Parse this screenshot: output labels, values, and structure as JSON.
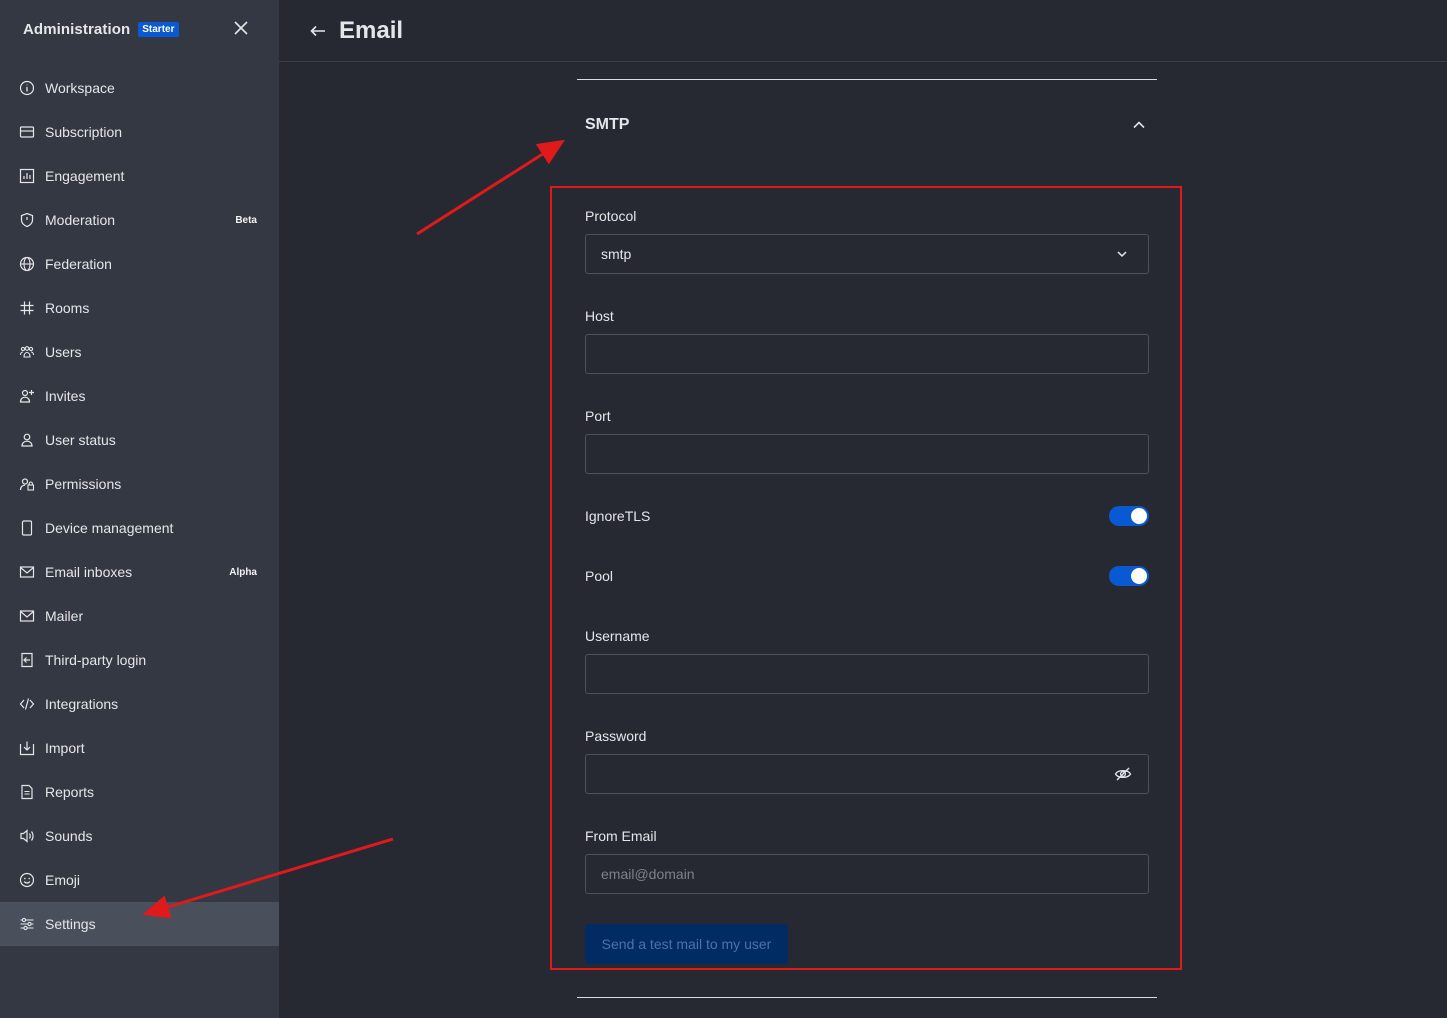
{
  "sidebar": {
    "title": "Administration",
    "badge": "Starter",
    "items": [
      {
        "label": "Workspace",
        "icon": "info-icon"
      },
      {
        "label": "Subscription",
        "icon": "card-icon"
      },
      {
        "label": "Engagement",
        "icon": "bar-chart-icon"
      },
      {
        "label": "Moderation",
        "icon": "shield-icon",
        "tag": "Beta"
      },
      {
        "label": "Federation",
        "icon": "globe-icon"
      },
      {
        "label": "Rooms",
        "icon": "hash-icon"
      },
      {
        "label": "Users",
        "icon": "team-icon"
      },
      {
        "label": "Invites",
        "icon": "user-plus-icon"
      },
      {
        "label": "User status",
        "icon": "user-icon"
      },
      {
        "label": "Permissions",
        "icon": "user-lock-icon"
      },
      {
        "label": "Device management",
        "icon": "mobile-icon"
      },
      {
        "label": "Email inboxes",
        "icon": "mail-icon",
        "tag": "Alpha"
      },
      {
        "label": "Mailer",
        "icon": "mail-icon"
      },
      {
        "label": "Third-party login",
        "icon": "login-icon"
      },
      {
        "label": "Integrations",
        "icon": "code-icon"
      },
      {
        "label": "Import",
        "icon": "import-icon"
      },
      {
        "label": "Reports",
        "icon": "document-icon"
      },
      {
        "label": "Sounds",
        "icon": "volume-icon"
      },
      {
        "label": "Emoji",
        "icon": "emoji-icon"
      },
      {
        "label": "Settings",
        "icon": "sliders-icon",
        "active": true
      }
    ]
  },
  "header": {
    "title": "Email"
  },
  "section": {
    "title": "SMTP"
  },
  "form": {
    "protocol": {
      "label": "Protocol",
      "value": "smtp"
    },
    "host": {
      "label": "Host",
      "value": ""
    },
    "port": {
      "label": "Port",
      "value": ""
    },
    "ignore_tls": {
      "label": "IgnoreTLS",
      "enabled": true
    },
    "pool": {
      "label": "Pool",
      "enabled": true
    },
    "username": {
      "label": "Username",
      "value": ""
    },
    "password": {
      "label": "Password",
      "value": ""
    },
    "from_email": {
      "label": "From Email",
      "value": "",
      "placeholder": "email@domain"
    },
    "test_button": "Send a test mail to my user"
  },
  "colors": {
    "accent": "#095ad2",
    "annotation": "#e01a1a",
    "sidebar_bg": "#343842",
    "main_bg": "#262932"
  }
}
